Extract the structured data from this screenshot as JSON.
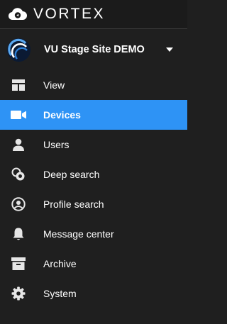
{
  "brand": {
    "name": "VORTEX",
    "logo_icon": "vortex-cloud-logo"
  },
  "site": {
    "name": "VU Stage Site DEMO",
    "avatar_icon": "site-avatar",
    "dropdown_icon": "caret-down-icon"
  },
  "nav": {
    "items": [
      {
        "label": "View",
        "icon": "view-layout-icon",
        "active": false
      },
      {
        "label": "Devices",
        "icon": "camera-icon",
        "active": true
      },
      {
        "label": "Users",
        "icon": "user-icon",
        "active": false
      },
      {
        "label": "Deep search",
        "icon": "deep-search-icon",
        "active": false
      },
      {
        "label": "Profile search",
        "icon": "profile-search-icon",
        "active": false
      },
      {
        "label": "Message center",
        "icon": "bell-icon",
        "active": false
      },
      {
        "label": "Archive",
        "icon": "archive-icon",
        "active": false
      },
      {
        "label": "System",
        "icon": "gear-icon",
        "active": false
      }
    ]
  },
  "colors": {
    "background": "#1f1f1f",
    "active_background": "#2e93f5",
    "text": "#ffffff",
    "icon": "#e6e6e6"
  }
}
